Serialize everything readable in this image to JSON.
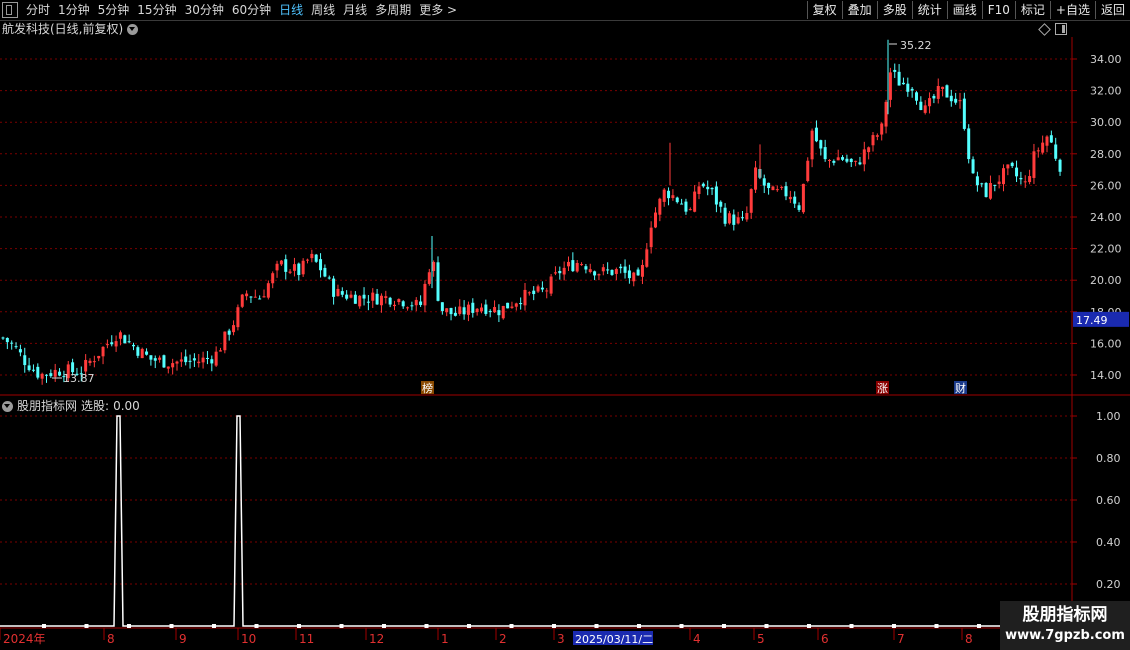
{
  "toolbar": {
    "periods": [
      "分时",
      "1分钟",
      "5分钟",
      "15分钟",
      "30分钟",
      "60分钟",
      "日线",
      "周线",
      "月线",
      "多周期",
      "更多 >"
    ],
    "active_period": "日线",
    "buttons": [
      "复权",
      "叠加",
      "多股",
      "统计",
      "画线",
      "F10",
      "标记",
      "+自选",
      "返回"
    ]
  },
  "chart": {
    "title": "航发科技(日线,前复权)",
    "high_label": "35.22",
    "low_label": "13.87",
    "current_price": "17.49",
    "markers": {
      "bang": "榜",
      "zhang": "涨",
      "cai": "财"
    },
    "y_ticks": [
      "34.00",
      "32.00",
      "30.00",
      "28.00",
      "26.00",
      "24.00",
      "22.00",
      "20.00",
      "18.00",
      "16.00",
      "14.00"
    ],
    "colors": {
      "up": "#ff3b3b",
      "down": "#54ffff",
      "grid": "#7a0000",
      "axis": "#a00000"
    }
  },
  "indicator": {
    "name": "股朋指标网",
    "series_label": "选股:",
    "series_value": "0.00",
    "y_ticks": [
      "1.00",
      "0.80",
      "0.60",
      "0.40",
      "0.20"
    ],
    "signal": [
      0,
      0,
      0,
      0,
      0,
      0,
      0,
      0,
      0,
      0,
      0,
      0,
      0,
      0,
      0,
      0,
      0,
      0,
      0,
      0,
      0,
      0,
      0,
      0,
      0,
      0,
      0,
      0,
      0,
      0,
      0,
      0,
      0,
      0,
      0,
      0,
      0,
      0,
      0,
      0,
      0,
      0,
      0,
      0,
      0,
      0,
      0,
      0,
      0,
      0,
      0,
      0,
      0,
      0,
      0,
      0,
      0,
      0,
      0,
      0,
      0,
      0,
      0,
      0,
      0,
      0,
      0,
      0,
      0,
      0,
      0,
      0,
      0,
      0,
      0,
      0,
      0,
      0,
      0,
      0
    ]
  },
  "time_axis": {
    "labels": [
      "2024年",
      "8",
      "9",
      "10",
      "11",
      "12",
      "1",
      "2",
      "3",
      "4",
      "5",
      "6",
      "7",
      "8",
      "9"
    ],
    "highlight": "2025/03/11/二"
  },
  "watermark": {
    "line1": "股朋指标网",
    "line2": "www.7gpzb.com"
  }
}
